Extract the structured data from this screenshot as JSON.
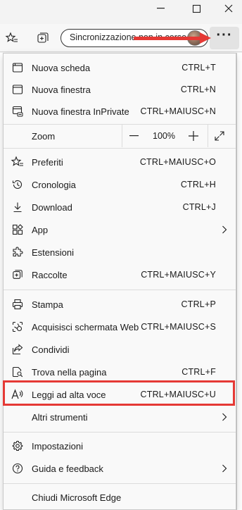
{
  "toolbar": {
    "sync_label": "Sincronizzazione non in corso",
    "more_label": "···"
  },
  "menu": {
    "items": [
      {
        "label": "Nuova scheda",
        "shortcut": "CTRL+T",
        "icon": "new-tab-icon"
      },
      {
        "label": "Nuova finestra",
        "shortcut": "CTRL+N",
        "icon": "new-window-icon"
      },
      {
        "label": "Nuova finestra InPrivate",
        "shortcut": "CTRL+MAIUSC+N",
        "icon": "inprivate-icon"
      },
      {
        "label": "Zoom",
        "zoom_value": "100%",
        "icon": ""
      },
      {
        "label": "Preferiti",
        "shortcut": "CTRL+MAIUSC+O",
        "icon": "favorites-icon"
      },
      {
        "label": "Cronologia",
        "shortcut": "CTRL+H",
        "icon": "history-icon"
      },
      {
        "label": "Download",
        "shortcut": "CTRL+J",
        "icon": "download-icon"
      },
      {
        "label": "App",
        "shortcut": "",
        "icon": "apps-icon"
      },
      {
        "label": "Estensioni",
        "shortcut": "",
        "icon": "extensions-icon"
      },
      {
        "label": "Raccolte",
        "shortcut": "CTRL+MAIUSC+Y",
        "icon": "collections-icon"
      },
      {
        "label": "Stampa",
        "shortcut": "CTRL+P",
        "icon": "print-icon"
      },
      {
        "label": "Acquisisci schermata Web",
        "shortcut": "CTRL+MAIUSC+S",
        "icon": "web-capture-icon"
      },
      {
        "label": "Condividi",
        "shortcut": "",
        "icon": "share-icon"
      },
      {
        "label": "Trova nella pagina",
        "shortcut": "CTRL+F",
        "icon": "find-icon"
      },
      {
        "label": "Leggi ad alta voce",
        "shortcut": "CTRL+MAIUSC+U",
        "icon": "read-aloud-icon"
      },
      {
        "label": "Altri strumenti",
        "shortcut": "",
        "icon": ""
      },
      {
        "label": "Impostazioni",
        "shortcut": "",
        "icon": "settings-icon"
      },
      {
        "label": "Guida e feedback",
        "shortcut": "",
        "icon": "help-icon"
      },
      {
        "label": "Chiudi Microsoft Edge",
        "shortcut": "",
        "icon": ""
      }
    ]
  },
  "colors": {
    "annotation_red": "#e53935",
    "menu_bg": "#f9f9f9"
  }
}
